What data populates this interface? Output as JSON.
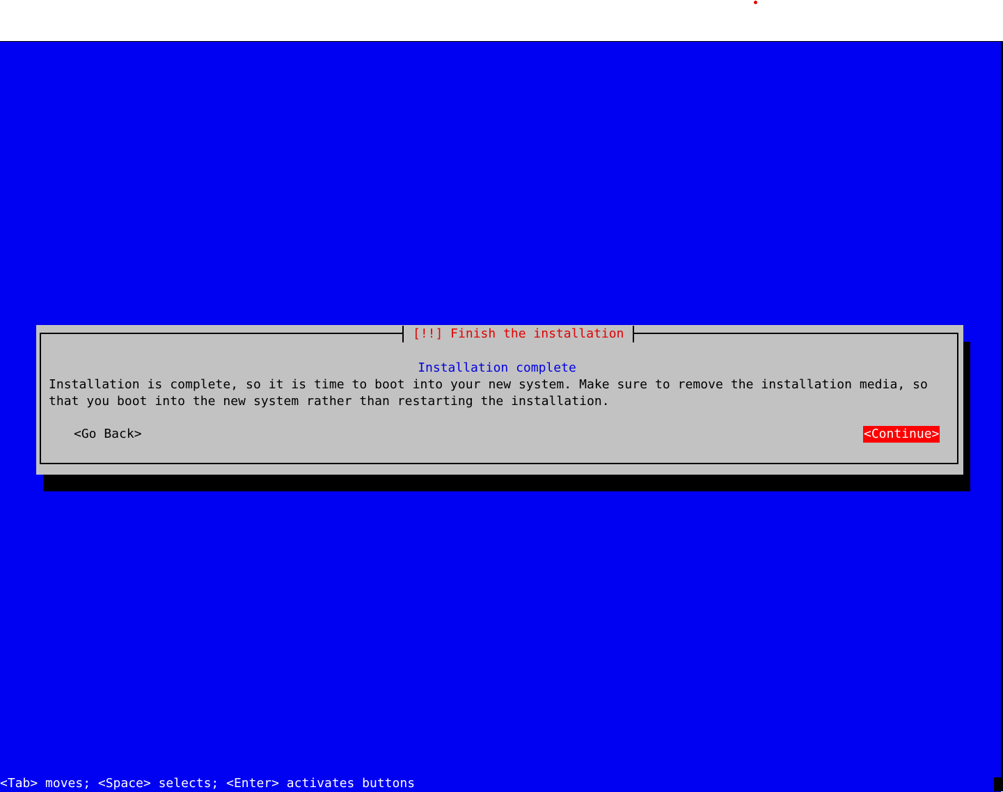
{
  "colors": {
    "screen_bg": "#0000f2",
    "dialog_bg": "#c2c2c2",
    "title_color": "#e00000",
    "subtitle_color": "#0000e0",
    "selected_button_bg": "#ff0000",
    "selected_button_fg": "#ffffff",
    "status_fg": "#ffffff"
  },
  "dialog": {
    "title": "[!!] Finish the installation",
    "subtitle": "Installation complete",
    "message": "Installation is complete, so it is time to boot into your new system. Make sure to remove the installation media, so that you boot into the new system rather than restarting the installation.",
    "buttons": {
      "go_back": "<Go Back>",
      "continue": "<Continue>"
    },
    "selected_button": "continue"
  },
  "status_line": "<Tab> moves; <Space> selects; <Enter> activates buttons"
}
